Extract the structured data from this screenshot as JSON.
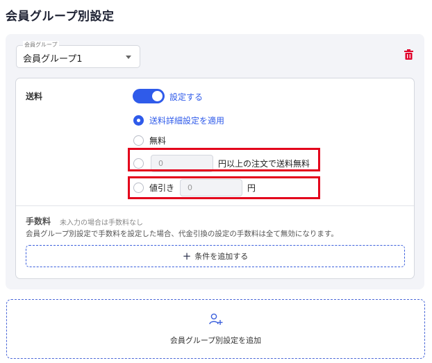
{
  "page": {
    "title": "会員グループ別設定"
  },
  "group": {
    "select_label": "会員グループ",
    "select_value": "会員グループ1"
  },
  "shipping": {
    "label": "送料",
    "toggle_label": "設定する",
    "toggle_on": true,
    "options": {
      "detail": "送料詳細設定を適用",
      "free": "無料",
      "threshold_value": "0",
      "threshold_suffix": "円以上の注文で送料無料",
      "discount_label": "値引き",
      "discount_value": "0",
      "discount_suffix": "円"
    },
    "selected_option": "detail"
  },
  "fee": {
    "label": "手数料",
    "hint": "未入力の場合は手数料なし",
    "note": "会員グループ別設定で手数料を設定した場合、代金引換の設定の手数料は全て無効になります。",
    "add_condition_label": "条件を追加する"
  },
  "add_group": {
    "label": "会員グループ別設定を追加"
  },
  "colors": {
    "accent": "#2f5bea",
    "delete": "#e0002a",
    "highlight": "#e3001b",
    "panel_bg": "#f3f4f8"
  },
  "icons": {
    "delete": "trash-icon",
    "dropdown": "caret-down-icon",
    "add": "plus-icon",
    "add_group": "user-plus-icon"
  }
}
